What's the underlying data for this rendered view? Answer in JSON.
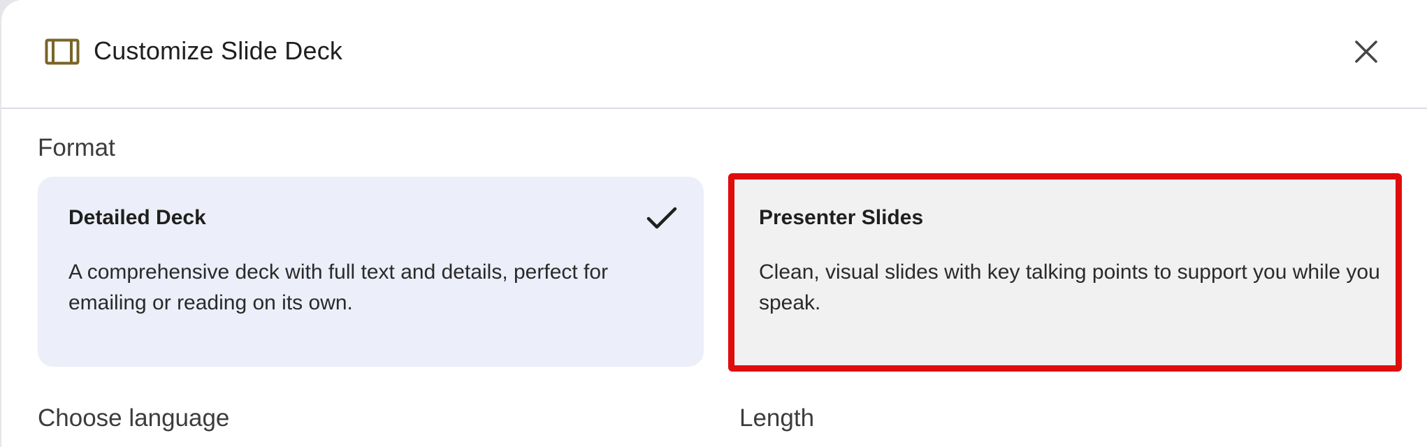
{
  "dialog": {
    "title": "Customize Slide Deck",
    "title_icon": "slides-icon",
    "close_icon": "close-icon"
  },
  "format": {
    "label": "Format",
    "options": [
      {
        "title": "Detailed Deck",
        "description": "A comprehensive deck with full text and details, perfect for emailing or reading on its own.",
        "selected": true,
        "icon": "check-icon"
      },
      {
        "title": "Presenter Slides",
        "description": "Clean, visual slides with key talking points to support you while you speak.",
        "selected": false,
        "highlighted": true
      }
    ]
  },
  "language": {
    "label": "Choose language"
  },
  "length": {
    "label": "Length"
  },
  "colors": {
    "icon_gold": "#7a6428",
    "selected_card_bg": "#eceef9",
    "card_bg": "#f1f1f1",
    "highlight_border": "#e00d0d"
  }
}
